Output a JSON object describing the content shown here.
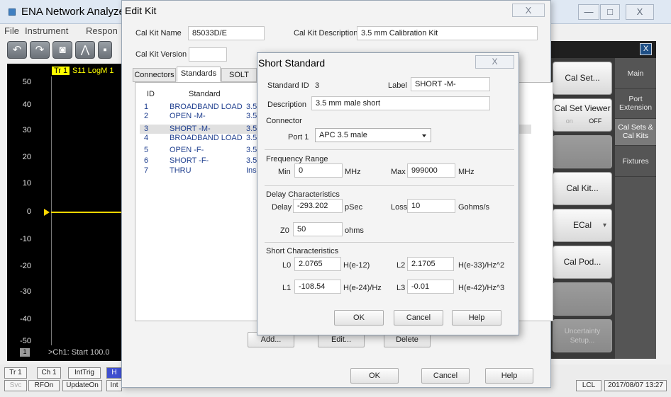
{
  "ena": {
    "title": "ENA Network Analyzer",
    "window_buttons": [
      "—",
      "□",
      "X"
    ],
    "menu": [
      "File",
      "Instrument",
      "Respon"
    ],
    "toolbar": [
      "undo-icon",
      "redo-icon",
      "camera-icon",
      "marker-icon",
      "more-icon"
    ],
    "plot": {
      "trace_tag": "Tr 1",
      "trace_label": "S11 LogM 1",
      "y_ticks": [
        "50",
        "40",
        "30",
        "20",
        "10",
        "0",
        "-10",
        "-20",
        "-30",
        "-40",
        "-50"
      ],
      "status_box": "1",
      "status_text": ">Ch1: Start 100.0"
    },
    "statusbar": {
      "row1": [
        "Tr 1",
        "Ch 1",
        "IntTrig",
        "H"
      ],
      "row2": [
        "Svc",
        "RFOn",
        "UpdateOn",
        "Int"
      ],
      "right": [
        "LCL",
        "2017/08/07 13:27"
      ]
    }
  },
  "softkeys": {
    "close": "X",
    "buttons": [
      {
        "label": "Cal Set...",
        "state": "normal"
      },
      {
        "label": "Cal Set Viewer",
        "state": "toggle",
        "toggle_off": "on",
        "toggle_on": "OFF"
      },
      {
        "label": "",
        "state": "empty"
      },
      {
        "label": "Cal Kit...",
        "state": "normal"
      },
      {
        "label": "ECal",
        "state": "dropdown"
      },
      {
        "label": "Cal Pod...",
        "state": "normal"
      },
      {
        "label": "",
        "state": "empty"
      },
      {
        "label": "Uncertainty Setup...",
        "state": "disabled"
      }
    ],
    "tabs": [
      {
        "label": "Main",
        "active": false
      },
      {
        "label": "Port Extension",
        "active": false
      },
      {
        "label": "Cal Sets & Cal Kits",
        "active": true
      },
      {
        "label": "Fixtures",
        "active": false
      }
    ]
  },
  "editkit": {
    "title": "Edit Kit",
    "close": "X",
    "cal_kit_name_label": "Cal Kit Name",
    "cal_kit_name": "85033D/E",
    "cal_kit_desc_label": "Cal Kit Description",
    "cal_kit_desc": "3.5 mm Calibration Kit",
    "cal_kit_version_label": "Cal Kit Version",
    "cal_kit_version": "",
    "tabs": [
      {
        "label": "Connectors",
        "active": false
      },
      {
        "label": "Standards",
        "active": true
      },
      {
        "label": "SOLT",
        "active": false
      }
    ],
    "list_headers": {
      "id": "ID",
      "standard": "Standard"
    },
    "rows": [
      {
        "id": "1",
        "standard": "BROADBAND LOAD",
        "desc": "3.5",
        "selected": false
      },
      {
        "id": "2",
        "standard": "OPEN -M-",
        "desc": "3.5",
        "selected": false
      },
      {
        "id": "3",
        "standard": "SHORT -M-",
        "desc": "3.5",
        "selected": true
      },
      {
        "id": "4",
        "standard": "BROADBAND LOAD",
        "desc": "3.5",
        "selected": false
      },
      {
        "id": "5",
        "standard": "OPEN -F-",
        "desc": "3.5",
        "selected": false
      },
      {
        "id": "6",
        "standard": "SHORT -F-",
        "desc": "3.5",
        "selected": false
      },
      {
        "id": "7",
        "standard": "THRU",
        "desc": "Ins",
        "selected": false
      }
    ],
    "buttons": {
      "add": "Add...",
      "edit": "Edit...",
      "delete": "Delete",
      "ok": "OK",
      "cancel": "Cancel",
      "help": "Help"
    }
  },
  "short_standard": {
    "title": "Short Standard",
    "close": "X",
    "standard_id_label": "Standard ID",
    "standard_id": "3",
    "label_label": "Label",
    "label": "SHORT -M-",
    "description_label": "Description",
    "description": "3.5 mm male short",
    "connector_group": "Connector",
    "port1_label": "Port 1",
    "port1_value": "APC 3.5 male",
    "freq_group": "Frequency Range",
    "min_label": "Min",
    "min_value": "0",
    "min_unit": "MHz",
    "max_label": "Max",
    "max_value": "999000",
    "max_unit": "MHz",
    "delay_group": "Delay Characteristics",
    "delay_label": "Delay",
    "delay_value": "-293.202",
    "delay_unit": "pSec",
    "loss_label": "Loss",
    "loss_value": "10",
    "loss_unit": "Gohms/s",
    "z0_label": "Z0",
    "z0_value": "50",
    "z0_unit": "ohms",
    "short_group": "Short Characteristics",
    "l0_label": "L0",
    "l0_value": "2.0765",
    "l0_unit": "H(e-12)",
    "l2_label": "L2",
    "l2_value": "2.1705",
    "l2_unit": "H(e-33)/Hz^2",
    "l1_label": "L1",
    "l1_value": "-108.54",
    "l1_unit": "H(e-24)/Hz",
    "l3_label": "L3",
    "l3_value": "-0.01",
    "l3_unit": "H(e-42)/Hz^3",
    "buttons": {
      "ok": "OK",
      "cancel": "Cancel",
      "help": "Help"
    }
  }
}
